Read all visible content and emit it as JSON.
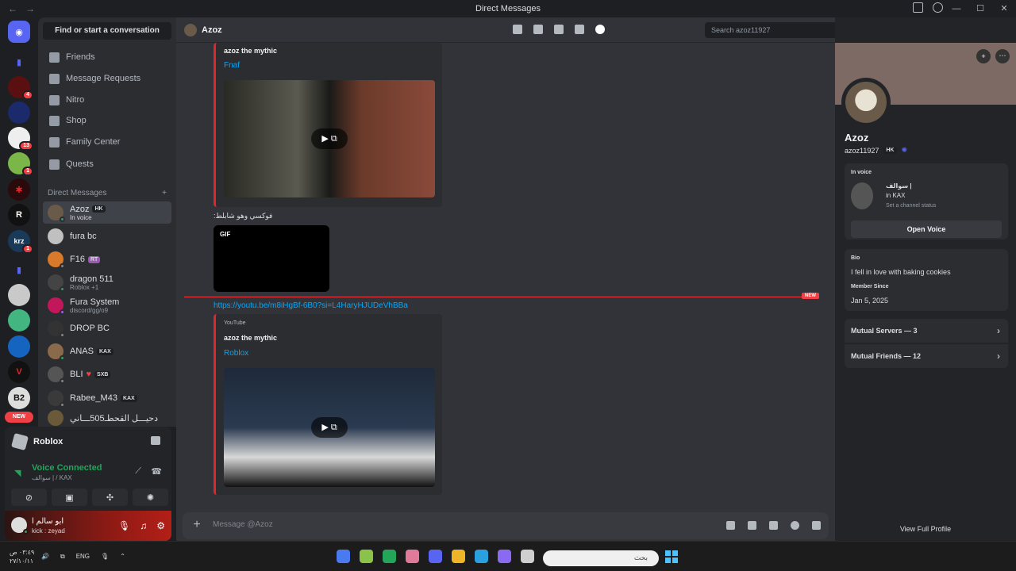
{
  "window": {
    "title": "Direct Messages"
  },
  "guilds": [
    {
      "badge": "4"
    },
    {
      "badge": ""
    },
    {
      "badge": "13"
    },
    {
      "badge": "1"
    },
    {
      "badge": ""
    },
    {
      "badge": ""
    },
    {
      "badge": "1"
    },
    {
      "badge": ""
    },
    {
      "badge": ""
    },
    {
      "badge": ""
    },
    {
      "badge": ""
    },
    {
      "badge": ""
    },
    {
      "badge": ""
    }
  ],
  "guild_labels": {
    "r": "R",
    "krz": "krz",
    "b2": "B2",
    "new": "NEW"
  },
  "sidebar": {
    "find_label": "Find or start a conversation",
    "nav": [
      "Friends",
      "Message Requests",
      "Nitro",
      "Shop",
      "Family Center",
      "Quests"
    ],
    "dm_header": "Direct Messages",
    "add_icon": "+",
    "dms": [
      {
        "name": "Azoz",
        "tag": "HK",
        "sub": "In voice",
        "status": "#23a55a"
      },
      {
        "name": "fura bc",
        "tag": "",
        "sub": "",
        "status": ""
      },
      {
        "name": "F16",
        "tag": "RT",
        "sub": "",
        "status": "#80848e"
      },
      {
        "name": "dragon 511",
        "tag": "",
        "sub": "Roblox +1",
        "status": "#23a55a"
      },
      {
        "name": "Fura System",
        "tag": "",
        "sub": "discord/gg/o9",
        "status": "#a855f7"
      },
      {
        "name": "DROP BC",
        "tag": "",
        "sub": "",
        "status": "#80848e"
      },
      {
        "name": "ANAS",
        "tag": "KAX",
        "sub": "",
        "status": "#23a55a"
      },
      {
        "name": "BLI",
        "tag": "SXB",
        "sub": "",
        "status": "#80848e"
      },
      {
        "name": "Rabee_M43",
        "tag": "KAX",
        "sub": "",
        "status": "#80848e"
      },
      {
        "name": "دحيـــل القحطـ505ـــاني",
        "tag": "",
        "sub": "",
        "status": ""
      }
    ]
  },
  "voice": {
    "activity": "Roblox",
    "status": "Voice Connected",
    "channel": "سوالف | / KAX"
  },
  "user": {
    "name": "ابو سالم ا",
    "sub": "kick : zeyad"
  },
  "chat": {
    "recipient": "Azoz",
    "search_placeholder": "Search azoz11927",
    "embed1": {
      "author": "azoz the mythic",
      "title": "Fnaf"
    },
    "arabic_msg": "فوكسي وهو شابلط:",
    "gif_label": "GIF",
    "new_label": "NEW",
    "link": "https://youtu.be/m8iHgBf-6B0?si=L4HaryHJUDeVhBBa",
    "embed2": {
      "provider": "YouTube",
      "author": "azoz the mythic",
      "title": "Roblox"
    },
    "composer_placeholder": "Message @Azoz"
  },
  "profile": {
    "name": "Azoz",
    "username": "azoz11927",
    "tag": "HK",
    "in_voice_label": "In voice",
    "voice_channel": "سوالف |",
    "voice_server": "in KAX",
    "channel_status": "Set a channel status",
    "open_voice": "Open Voice",
    "bio_label": "Bio",
    "bio": "I fell in love with baking cookies",
    "member_since_label": "Member Since",
    "member_since": "Jan 5, 2025",
    "mutual_servers": "Mutual Servers — 3",
    "mutual_friends": "Mutual Friends — 12",
    "view_full": "View Full Profile"
  },
  "taskbar": {
    "time": "٠٣:٤٩ ص",
    "date": "٢٧/١٠/١١",
    "lang": "ENG",
    "search_placeholder": "بحث"
  },
  "colors": {
    "accent": "#5865f2",
    "online": "#23a55a",
    "danger": "#f23f43",
    "link": "#00a8fc"
  }
}
